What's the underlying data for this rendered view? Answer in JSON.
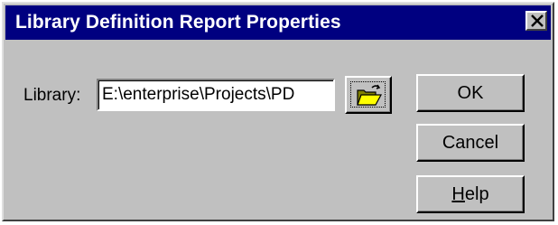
{
  "window": {
    "title": "Library Definition Report Properties",
    "close_icon": "close-x-icon"
  },
  "form": {
    "library_label": "Library:",
    "library_value": "E:\\enterprise\\Projects\\PD",
    "browse_icon": "open-folder-icon"
  },
  "buttons": {
    "ok_label": "OK",
    "cancel_label": "Cancel",
    "help_mnemonic": "H",
    "help_rest": "elp"
  },
  "colors": {
    "titlebar": "#000080",
    "face": "#c0c0c0",
    "title_text": "#ffffff"
  }
}
